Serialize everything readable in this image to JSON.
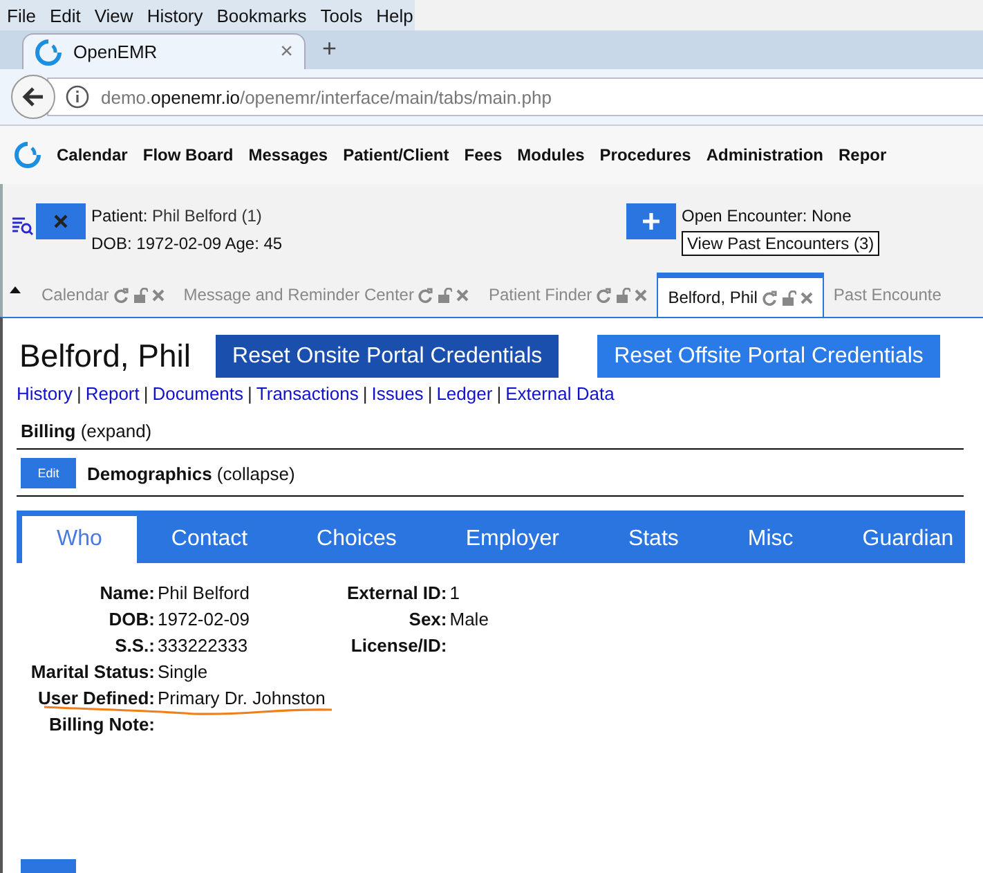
{
  "browser": {
    "menu": [
      "File",
      "Edit",
      "View",
      "History",
      "Bookmarks",
      "Tools",
      "Help"
    ],
    "tab": {
      "title": "OpenEMR",
      "close": "×",
      "new_tab": "+"
    },
    "url": {
      "sub": "demo.",
      "host": "openemr.io",
      "path": "/openemr/interface/main/tabs/main.php"
    }
  },
  "nav": [
    "Calendar",
    "Flow Board",
    "Messages",
    "Patient/Client",
    "Fees",
    "Modules",
    "Procedures",
    "Administration",
    "Repor"
  ],
  "patient_bar": {
    "patient_label": "Patient:",
    "patient_name": "Phil Belford (1)",
    "dob_line": "DOB: 1972-02-09 Age: 45",
    "encounter": "Open Encounter: None",
    "past_encounters": "View Past Encounters (3)"
  },
  "app_tabs": [
    {
      "label": "Calendar",
      "selected": false,
      "tools": true
    },
    {
      "label": "Message and Reminder Center",
      "selected": false,
      "tools": true
    },
    {
      "label": "Patient Finder",
      "selected": false,
      "tools": true
    },
    {
      "label": "Belford, Phil",
      "selected": true,
      "tools": true
    },
    {
      "label": "Past Encounte",
      "selected": false,
      "tools": false
    }
  ],
  "page": {
    "title": "Belford, Phil",
    "buttons": [
      {
        "label": "Reset Onsite Portal Credentials",
        "kind": "dark"
      },
      {
        "label": "Reset Offsite Portal Credentials",
        "kind": "light"
      }
    ],
    "separators": [
      "|",
      "|",
      "|",
      "|",
      "|",
      "|"
    ],
    "links": [
      "History",
      "Report",
      "Documents",
      "Transactions",
      "Issues",
      "Ledger",
      "External Data"
    ],
    "sections": [
      {
        "title": "Billing",
        "toggle": "(expand)"
      },
      {
        "title": "Demographics",
        "toggle": "(collapse)",
        "edit": "Edit"
      }
    ],
    "demo_tabs": [
      {
        "label": "Who",
        "selected": true
      },
      {
        "label": "Contact",
        "selected": false
      },
      {
        "label": "Choices",
        "selected": false
      },
      {
        "label": "Employer",
        "selected": false
      },
      {
        "label": "Stats",
        "selected": false
      },
      {
        "label": "Misc",
        "selected": false
      },
      {
        "label": "Guardian",
        "selected": false
      }
    ],
    "fields_left": [
      {
        "label": "Name:",
        "value": "Phil  Belford"
      },
      {
        "label": "DOB:",
        "value": "1972-02-09"
      },
      {
        "label": "S.S.:",
        "value": "333222333"
      },
      {
        "label": "Marital Status:",
        "value": "Single"
      },
      {
        "label": "User Defined:",
        "value": "Primary Dr. Johnston"
      },
      {
        "label": "Billing Note:"
      }
    ],
    "fields_right": [
      {
        "label": "External ID:",
        "value": "1"
      },
      {
        "label": "Sex:",
        "value": "Male"
      },
      {
        "label": "License/ID:"
      }
    ]
  }
}
